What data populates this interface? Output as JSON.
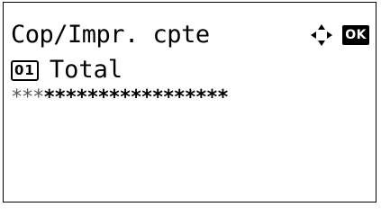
{
  "screen": {
    "title": "Cop/Impr. cpte",
    "nav_icon": "four-way-arrow-icon",
    "ok_key_label": "OK"
  },
  "item": {
    "number": "01",
    "label": "Total"
  },
  "counter": {
    "masked_value_faint": "***",
    "masked_value": "*****************"
  }
}
